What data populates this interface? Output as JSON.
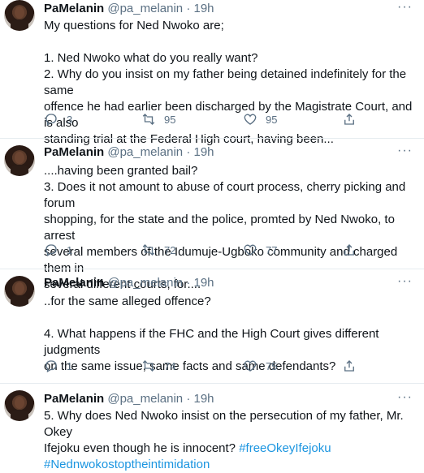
{
  "tweets": [
    {
      "name": "PaMelanin",
      "handle": "@pa_melanin",
      "sep": "·",
      "time": "",
      "more_icon": "more-icon",
      "lines": [
        "My questions for Ned Nwoko are;",
        "",
        "1. Ned Nwoko what  do you really want?",
        "2. Why do you  insist on my father being detained indefinitely for the same",
        "offence he had earlier been discharged by the Magistrate Court, and is also",
        "standing trial at the Federal High court, having been..."
      ],
      "replies": "3",
      "retweets": "95",
      "likes": "95"
    },
    {
      "name": "PaMelanin",
      "handle": "@pa_melanin",
      "sep": "·",
      "time": "19h",
      "more_icon": "more-icon",
      "lines": [
        "....having been granted bail?",
        "3. Does it not amount to abuse of court process, cherry picking and forum",
        "shopping, for the state and the police, promted by Ned Nwoko, to arrest",
        "several members of the Idumuje-Ugboko community and charged them in",
        "several different courts, for...."
      ],
      "replies": "1",
      "retweets": "72",
      "likes": "77"
    },
    {
      "name": "PaMelanin",
      "handle": "@pa_melanin",
      "sep": "·",
      "time": "19h",
      "more_icon": "more-icon",
      "lines": [
        "..for the same alleged offence?",
        "",
        "4. What happens if the FHC and the High Court gives different judgments",
        "on the same issue, same facts and same defendants?"
      ],
      "replies": "1",
      "retweets": "74",
      "likes": "75"
    },
    {
      "name": "PaMelanin",
      "handle": "@pa_melanin",
      "sep": "·",
      "time": "19h",
      "more_icon": "more-icon",
      "lines": [
        "5. Why does Ned Nwoko insist on the persecution of my father, Mr. Okey",
        "Ifejoku even though he is innocent? "
      ],
      "hashtag_inline": "#freeOkeyIfejoku",
      "hashtag_line": "#Nednwokostoptheintimidation"
    }
  ],
  "icons": {
    "reply": "reply-icon",
    "retweet": "retweet-icon",
    "like": "heart-icon",
    "share": "share-icon"
  },
  "colors": {
    "link": "#1b95e0",
    "muted": "#5b7083",
    "separator": "#e6ecf0"
  }
}
